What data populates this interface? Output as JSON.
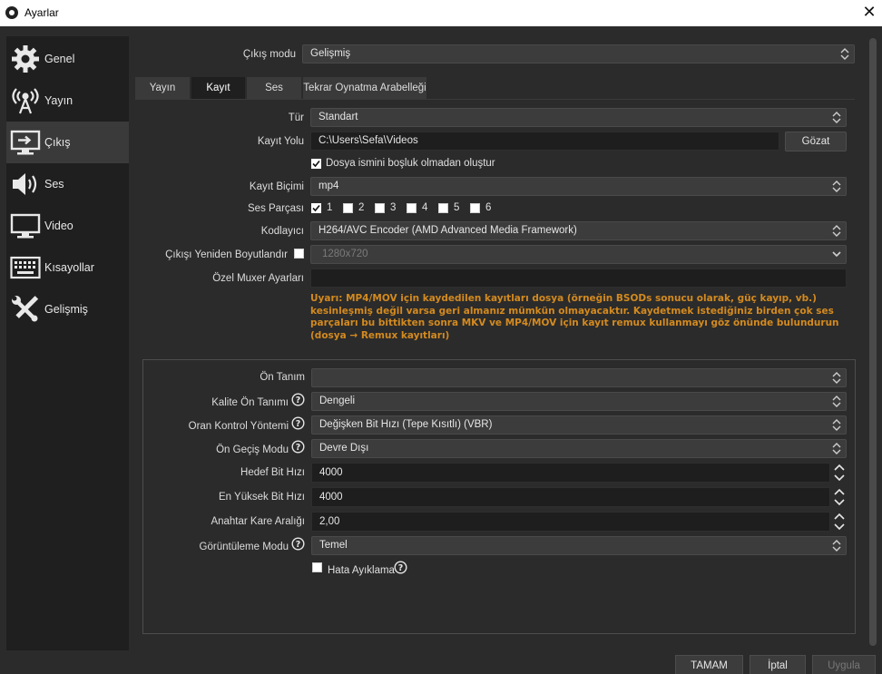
{
  "window": {
    "title": "Ayarlar"
  },
  "sidebar": {
    "items": [
      {
        "label": "Genel",
        "icon": "gear-icon"
      },
      {
        "label": "Yayın",
        "icon": "broadcast-antenna-icon"
      },
      {
        "label": "Çıkış",
        "icon": "output-monitor-icon",
        "active": true
      },
      {
        "label": "Ses",
        "icon": "speaker-icon"
      },
      {
        "label": "Video",
        "icon": "monitor-icon"
      },
      {
        "label": "Kısayollar",
        "icon": "keyboard-icon"
      },
      {
        "label": "Gelişmiş",
        "icon": "tools-icon"
      }
    ]
  },
  "output_mode": {
    "label": "Çıkış modu",
    "value": "Gelişmiş"
  },
  "tabs": [
    {
      "label": "Yayın"
    },
    {
      "label": "Kayıt",
      "active": true
    },
    {
      "label": "Ses"
    },
    {
      "label": "Tekrar Oynatma Arabelleği"
    }
  ],
  "recording": {
    "type": {
      "label": "Tür",
      "value": "Standart"
    },
    "path": {
      "label": "Kayıt Yolu",
      "value": "C:\\Users\\Sefa\\Videos",
      "browse": "Gözat"
    },
    "no_space": {
      "label": "Dosya ismini boşluk olmadan oluştur",
      "checked": true
    },
    "format": {
      "label": "Kayıt Biçimi",
      "value": "mp4"
    },
    "audio_tracks": {
      "label": "Ses Parçası",
      "tracks": [
        "1",
        "2",
        "3",
        "4",
        "5",
        "6"
      ],
      "checked": [
        true,
        false,
        false,
        false,
        false,
        false
      ]
    },
    "encoder": {
      "label": "Kodlayıcı",
      "value": "H264/AVC Encoder (AMD Advanced Media Framework)"
    },
    "rescale": {
      "label": "Çıkışı Yeniden Boyutlandır",
      "value": "1280x720",
      "checked": false
    },
    "muxer": {
      "label": "Özel Muxer Ayarları",
      "value": ""
    },
    "warning": "Uyarı: MP4/MOV için kaydedilen kayıtları dosya (örneğin BSODs sonucu olarak, güç kayıp, vb.) kesinleşmiş değil varsa geri almanız mümkün olmayacaktır. Kaydetmek istediğiniz birden çok ses parçaları bu bittikten sonra MKV ve MP4/MOV için kayıt remux kullanmayı göz önünde bulundurun (dosya → Remux kayıtları)"
  },
  "encoder_settings": {
    "preset": {
      "label": "Ön Tanım",
      "value": ""
    },
    "quality_preset": {
      "label": "Kalite Ön Tanımı",
      "value": "Dengeli"
    },
    "rate_control": {
      "label": "Oran Kontrol Yöntemi",
      "value": "Değişken Bit Hızı (Tepe Kısıtlı) (VBR)"
    },
    "prepass": {
      "label": "Ön Geçiş Modu",
      "value": "Devre Dışı"
    },
    "target_bitrate": {
      "label": "Hedef Bit Hızı",
      "value": "4000"
    },
    "max_bitrate": {
      "label": "En Yüksek Bit Hızı",
      "value": "4000"
    },
    "keyframe": {
      "label": "Anahtar Kare Aralığı",
      "value": "2,00"
    },
    "view_mode": {
      "label": "Görüntüleme Modu",
      "value": "Temel"
    },
    "debug": {
      "label": "Hata Ayıklama",
      "checked": false
    }
  },
  "buttons": {
    "ok": "TAMAM",
    "cancel": "İptal",
    "apply": "Uygula"
  },
  "colors": {
    "background": "#2b2b2b",
    "sidebar": "#1f1f1f",
    "warning": "#d38a1f"
  }
}
